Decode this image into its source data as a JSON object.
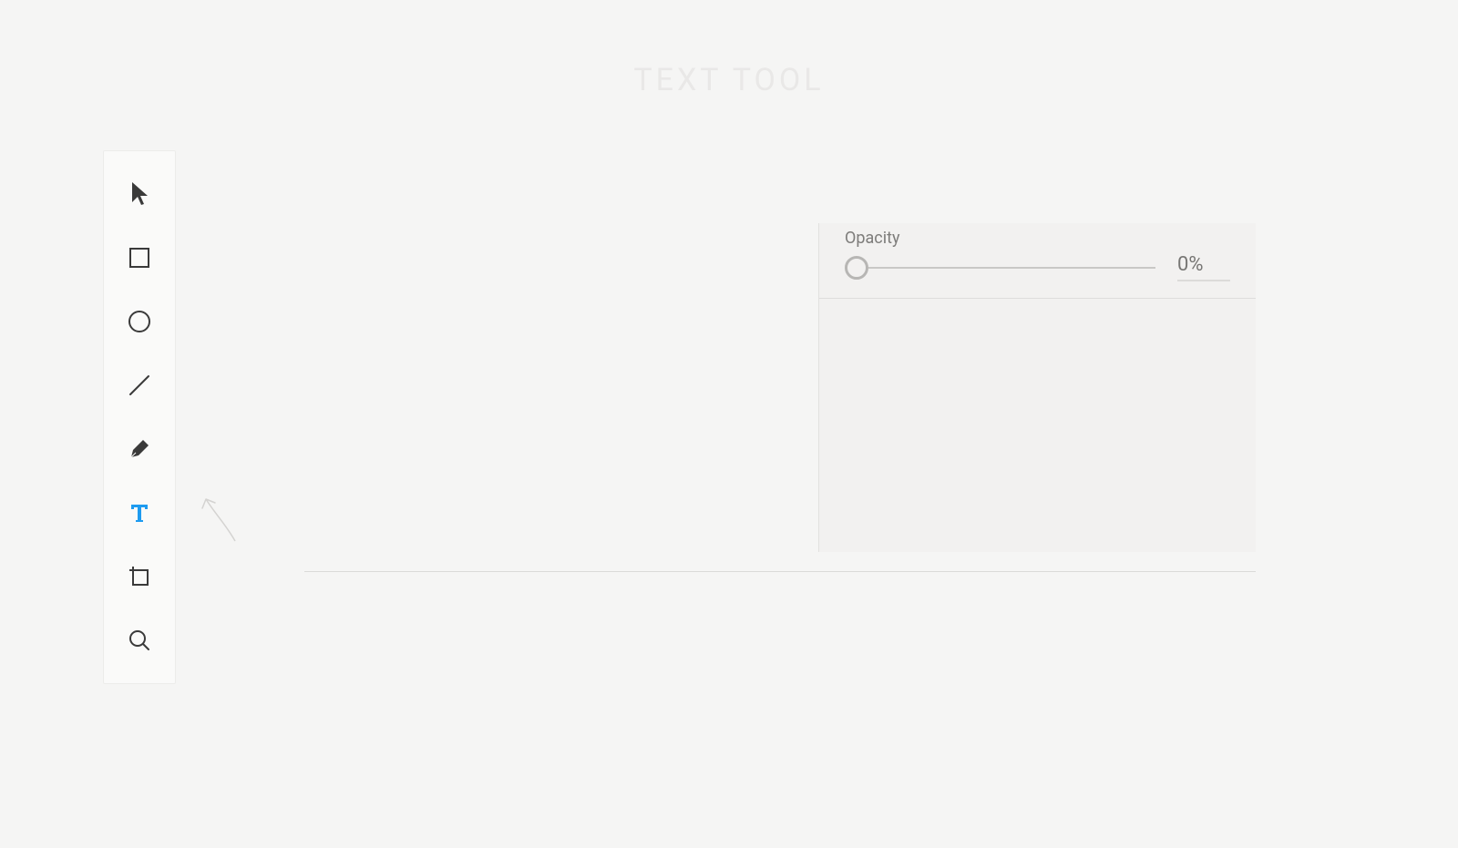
{
  "title": "TEXT TOOL",
  "toolbar": {
    "tools": [
      {
        "name": "select-tool",
        "icon": "cursor-icon",
        "active": false
      },
      {
        "name": "rectangle-tool",
        "icon": "rectangle-icon",
        "active": false
      },
      {
        "name": "ellipse-tool",
        "icon": "ellipse-icon",
        "active": false
      },
      {
        "name": "line-tool",
        "icon": "line-icon",
        "active": false
      },
      {
        "name": "pen-tool",
        "icon": "pen-icon",
        "active": false
      },
      {
        "name": "text-tool",
        "icon": "text-icon",
        "active": true
      },
      {
        "name": "artboard-tool",
        "icon": "artboard-icon",
        "active": false
      },
      {
        "name": "zoom-tool",
        "icon": "zoom-icon",
        "active": false
      }
    ]
  },
  "panel": {
    "opacity": {
      "label": "Opacity",
      "value": "0%",
      "slider_position": 0
    }
  },
  "colors": {
    "accent": "#1e9bf0",
    "icon": "#3a3a3a",
    "muted": "#7d7c7a"
  }
}
